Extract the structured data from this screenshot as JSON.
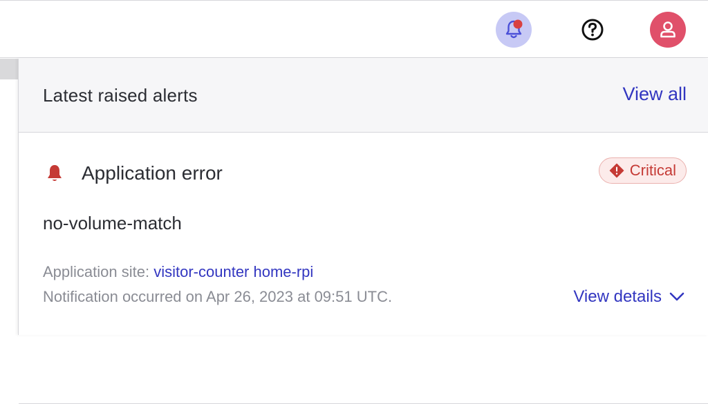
{
  "header": {
    "icons": {
      "notifications": "bell-icon",
      "help": "help-icon",
      "user": "user-icon"
    },
    "colors": {
      "notification_bg": "#c7c9f5",
      "notification_dot": "#d94040",
      "user_bg": "#e0506a"
    }
  },
  "alerts_panel": {
    "title": "Latest raised alerts",
    "view_all_label": "View all",
    "alert": {
      "title": "Application error",
      "severity": "Critical",
      "code": "no-volume-match",
      "site_label": "Application site:",
      "site_value": "visitor-counter home-rpi",
      "occurred_text": "Notification occurred on Apr 26, 2023 at 09:51 UTC.",
      "view_details_label": "View details",
      "colors": {
        "critical": "#c53a35",
        "link": "#3236c0"
      }
    }
  }
}
